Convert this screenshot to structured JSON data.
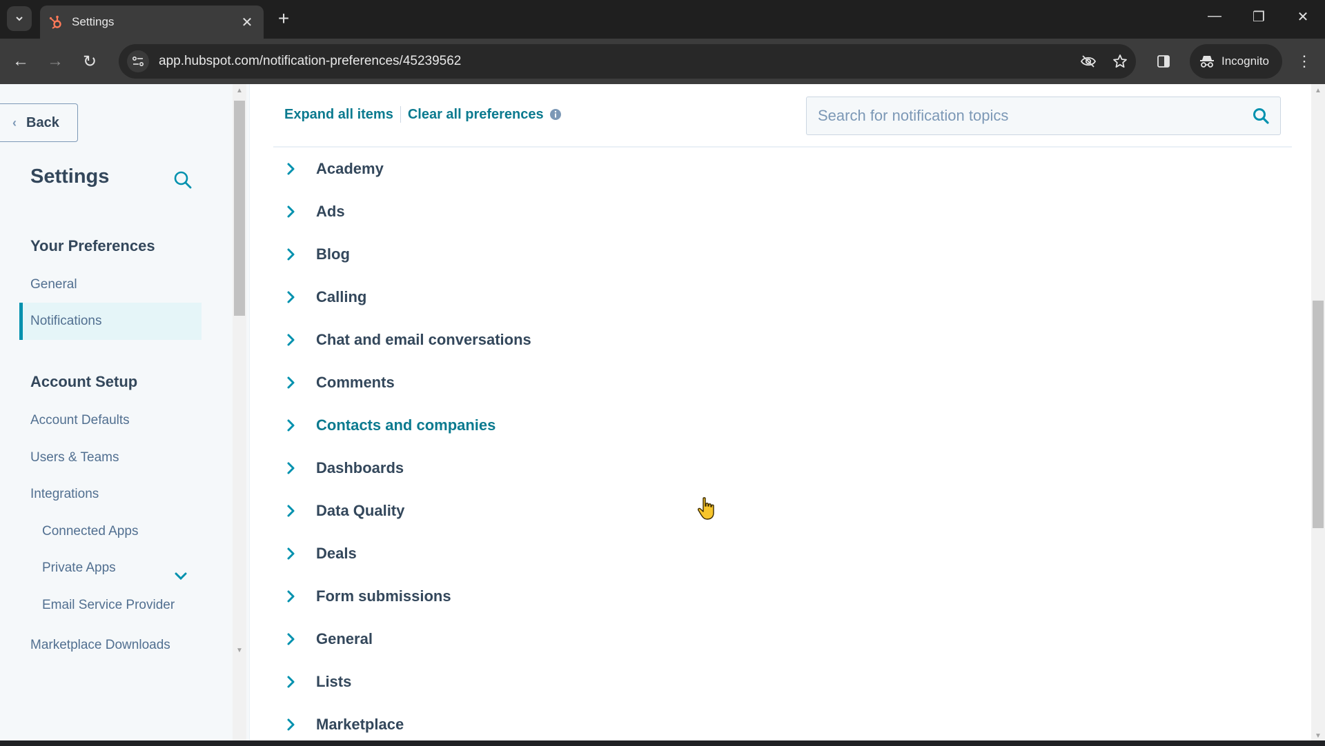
{
  "browser": {
    "tab_title": "Settings",
    "url": "app.hubspot.com/notification-preferences/45239562",
    "profile_label": "Incognito",
    "icons": {
      "tab_search": "chevron-down-icon",
      "favicon": "hubspot-sprocket-icon",
      "tab_close": "close-icon",
      "new_tab": "plus-icon",
      "back": "arrow-left-icon",
      "forward": "arrow-right-icon",
      "reload": "reload-icon",
      "site_info": "tune-icon",
      "tracking": "eye-off-icon",
      "bookmark": "star-icon",
      "side_panel": "side-panel-icon",
      "incognito": "incognito-icon",
      "menu": "kebab-menu-icon"
    },
    "glyphs": {
      "tab_close": "✕",
      "new_tab": "+",
      "back": "←",
      "forward": "→",
      "reload": "↻",
      "menu": "⋮",
      "minimize": "—",
      "restore": "❐",
      "close_window": "✕"
    }
  },
  "sidebar": {
    "back_label": "Back",
    "back_chevron": "‹",
    "title": "Settings",
    "sections": [
      {
        "heading": "Your Preferences",
        "items": [
          {
            "label": "General",
            "active": false
          },
          {
            "label": "Notifications",
            "active": true
          }
        ]
      },
      {
        "heading": "Account Setup",
        "items": [
          {
            "label": "Account Defaults"
          },
          {
            "label": "Users & Teams"
          },
          {
            "label": "Integrations",
            "expanded": true,
            "children": [
              "Connected Apps",
              "Private Apps",
              "Email Service Provider"
            ]
          },
          {
            "label": "Marketplace Downloads"
          }
        ]
      }
    ]
  },
  "main": {
    "expand_all_label": "Expand all items",
    "clear_all_label": "Clear all preferences",
    "search_placeholder": "Search for notification topics",
    "search_value": "",
    "topics": [
      "Academy",
      "Ads",
      "Blog",
      "Calling",
      "Chat and email conversations",
      "Comments",
      "Contacts and companies",
      "Dashboards",
      "Data Quality",
      "Deals",
      "Form submissions",
      "General",
      "Lists",
      "Marketplace"
    ],
    "hovered_topic": "Contacts and companies"
  },
  "colors": {
    "accent": "#0091ae",
    "link": "#0b7a8f",
    "text": "#33475b",
    "sidebar_bg": "#f5f8fa",
    "active_bg": "#e5f5f8"
  }
}
